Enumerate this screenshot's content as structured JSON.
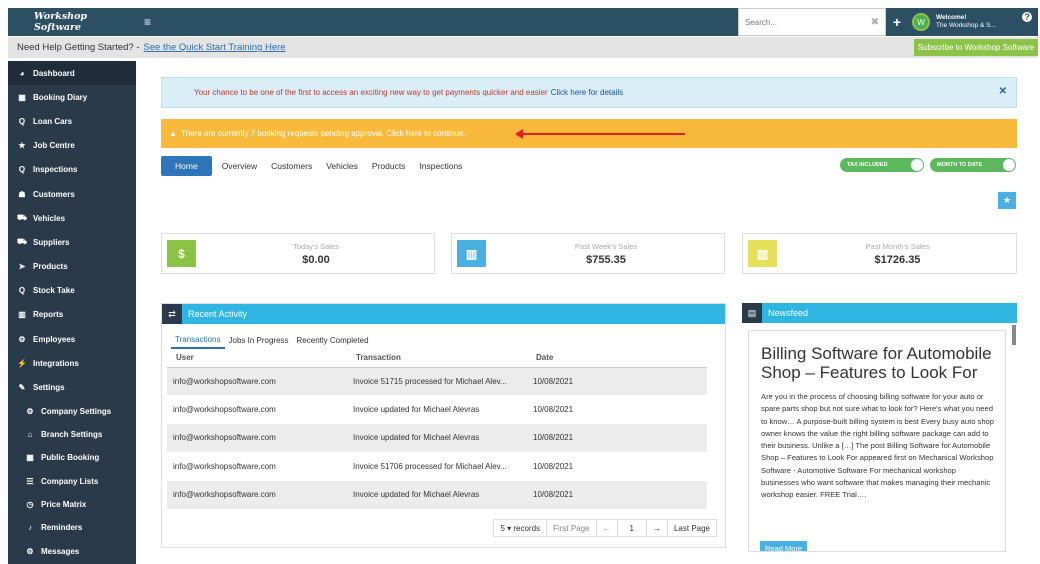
{
  "topbar": {
    "brand": "Workshop Software",
    "search_placeholder": "Search...",
    "welcome_line1": "Welcome!",
    "welcome_line2": "The Workshop & S..."
  },
  "helpstrip": {
    "text": "Need Help Getting Started? -",
    "link": "See the Quick Start Training Here",
    "subscribe": "Subscribe to Workshop Software"
  },
  "sidebar": {
    "items": [
      {
        "label": "Dashboard",
        "icon": "dashboard-icon",
        "glyph": "◕"
      },
      {
        "label": "Booking Diary",
        "icon": "calendar-icon",
        "glyph": "▦"
      },
      {
        "label": "Loan Cars",
        "icon": "search-icon",
        "glyph": "Q"
      },
      {
        "label": "Job Centre",
        "icon": "star-icon",
        "glyph": "★"
      },
      {
        "label": "Inspections",
        "icon": "search-icon",
        "glyph": "Q"
      },
      {
        "label": "Customers",
        "icon": "users-icon",
        "glyph": "☗"
      },
      {
        "label": "Vehicles",
        "icon": "car-icon",
        "glyph": "⛟"
      },
      {
        "label": "Suppliers",
        "icon": "truck-icon",
        "glyph": "⛟"
      },
      {
        "label": "Products",
        "icon": "tag-icon",
        "glyph": "➤"
      },
      {
        "label": "Stock Take",
        "icon": "search-icon",
        "glyph": "Q"
      },
      {
        "label": "Reports",
        "icon": "bar-chart-icon",
        "glyph": "▥"
      },
      {
        "label": "Employees",
        "icon": "cogs-icon",
        "glyph": "⚙"
      },
      {
        "label": "Integrations",
        "icon": "plug-icon",
        "glyph": "⚡"
      },
      {
        "label": "Settings",
        "icon": "wrench-icon",
        "glyph": "✎"
      }
    ],
    "subitems": [
      {
        "label": "Company Settings",
        "icon": "gear-icon",
        "glyph": "⚙"
      },
      {
        "label": "Branch Settings",
        "icon": "home-icon",
        "glyph": "⌂"
      },
      {
        "label": "Public Booking",
        "icon": "calendar-icon",
        "glyph": "▦"
      },
      {
        "label": "Company Lists",
        "icon": "list-icon",
        "glyph": "☰"
      },
      {
        "label": "Price Matrix",
        "icon": "clock-icon",
        "glyph": "◷"
      },
      {
        "label": "Reminders",
        "icon": "bell-icon",
        "glyph": "♪"
      },
      {
        "label": "Messages",
        "icon": "gear-icon",
        "glyph": "⚙"
      }
    ]
  },
  "alerts": {
    "blue_text": "Your chance to be one of the first to access an exciting new way to get payments quicker and easier",
    "blue_link": "Click here for details",
    "yellow_text": "There are currently 7 booking requests pending approval. Click here to continue."
  },
  "tabs": [
    "Home",
    "Overview",
    "Customers",
    "Vehicles",
    "Products",
    "Inspections"
  ],
  "toggles": {
    "tax": "TAX INCLUDED",
    "month": "MONTH TO DATE"
  },
  "stats": [
    {
      "label": "Today's Sales",
      "value": "$0.00",
      "glyph": "$",
      "color": "#8ac346"
    },
    {
      "label": "Past Week's Sales",
      "value": "$755.35",
      "glyph": "▥",
      "color": "#4ab0e2"
    },
    {
      "label": "Past Month's Sales",
      "value": "$1726.35",
      "glyph": "▥",
      "color": "#e6e05a"
    }
  ],
  "recent": {
    "title": "Recent Activity",
    "subtabs": [
      "Transactions",
      "Jobs In Progress",
      "Recently Completed"
    ],
    "columns": [
      "User",
      "Transaction",
      "Date"
    ],
    "rows": [
      [
        "info@workshopsoftware.com",
        "Invoice 51715 processed for Michael Alev...",
        "10/08/2021"
      ],
      [
        "info@workshopsoftware.com",
        "Invoice updated for Michael Alevras",
        "10/08/2021"
      ],
      [
        "info@workshopsoftware.com",
        "Invoice updated for Michael Alevras",
        "10/08/2021"
      ],
      [
        "info@workshopsoftware.com",
        "Invoice 51706 processed for Michael Alev...",
        "10/08/2021"
      ],
      [
        "info@workshopsoftware.com",
        "Invoice updated for Michael Alevras",
        "10/08/2021"
      ]
    ],
    "pager": {
      "size": "5",
      "records": "records",
      "first": "First Page",
      "prev": "←",
      "page": "1",
      "next": "→",
      "last": "Last Page"
    }
  },
  "newsfeed": {
    "title": "Newsfeed",
    "article_title": "Billing Software for Automobile Shop – Features to Look For",
    "article_text": "Are you in the process of choosing billing software for your auto or spare parts shop but not sure what to look for? Here's what you need to know… A purpose-built billing system is best Every busy auto shop owner knows the value the right billing software package can add to their business. Unlike a […] The post Billing Software for Automobile Shop – Features to Look For appeared first on Mechanical Workshop Software - Automotive Software For mechanical workshop businesses who want software that makes managing their mechanic workshop easier. FREE Trial….",
    "read_more": "Read More"
  }
}
